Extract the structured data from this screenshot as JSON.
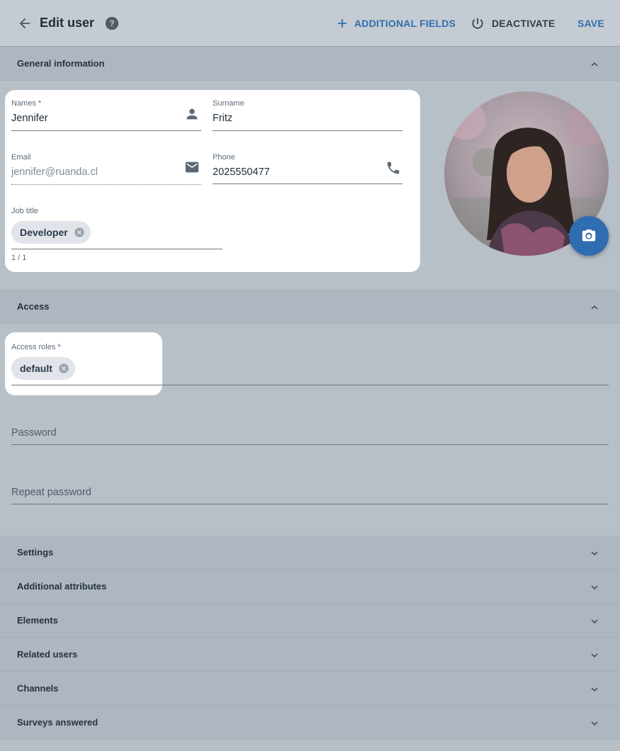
{
  "header": {
    "title": "Edit user",
    "actions": {
      "additional_fields": "ADDITIONAL FIELDS",
      "deactivate": "DEACTIVATE",
      "save": "SAVE"
    }
  },
  "sections": {
    "general": {
      "label": "General information",
      "expanded": true
    },
    "access": {
      "label": "Access",
      "expanded": true
    },
    "collapsed": [
      {
        "label": "Settings"
      },
      {
        "label": "Additional attributes"
      },
      {
        "label": "Elements"
      },
      {
        "label": "Related users"
      },
      {
        "label": "Channels"
      },
      {
        "label": "Surveys answered"
      }
    ]
  },
  "general": {
    "names": {
      "label": "Names *",
      "value": "Jennifer",
      "icon": "person-icon"
    },
    "surname": {
      "label": "Surname",
      "value": "Fritz"
    },
    "email": {
      "label": "Email",
      "value": "jennifer@ruanda.cl",
      "icon": "mail-icon"
    },
    "phone": {
      "label": "Phone",
      "value": "2025550477",
      "icon": "phone-icon"
    },
    "job_title": {
      "label": "Job title",
      "chip": "Developer",
      "counter": "1 / 1"
    }
  },
  "access": {
    "roles": {
      "label": "Access roles *",
      "chip": "default"
    },
    "password": {
      "placeholder": "Password"
    },
    "repeat_password": {
      "placeholder": "Repeat password"
    }
  },
  "colors": {
    "accent": "#2f6fae",
    "fab": "#2f6db0",
    "overlay_bg": "#b7bfc7"
  }
}
